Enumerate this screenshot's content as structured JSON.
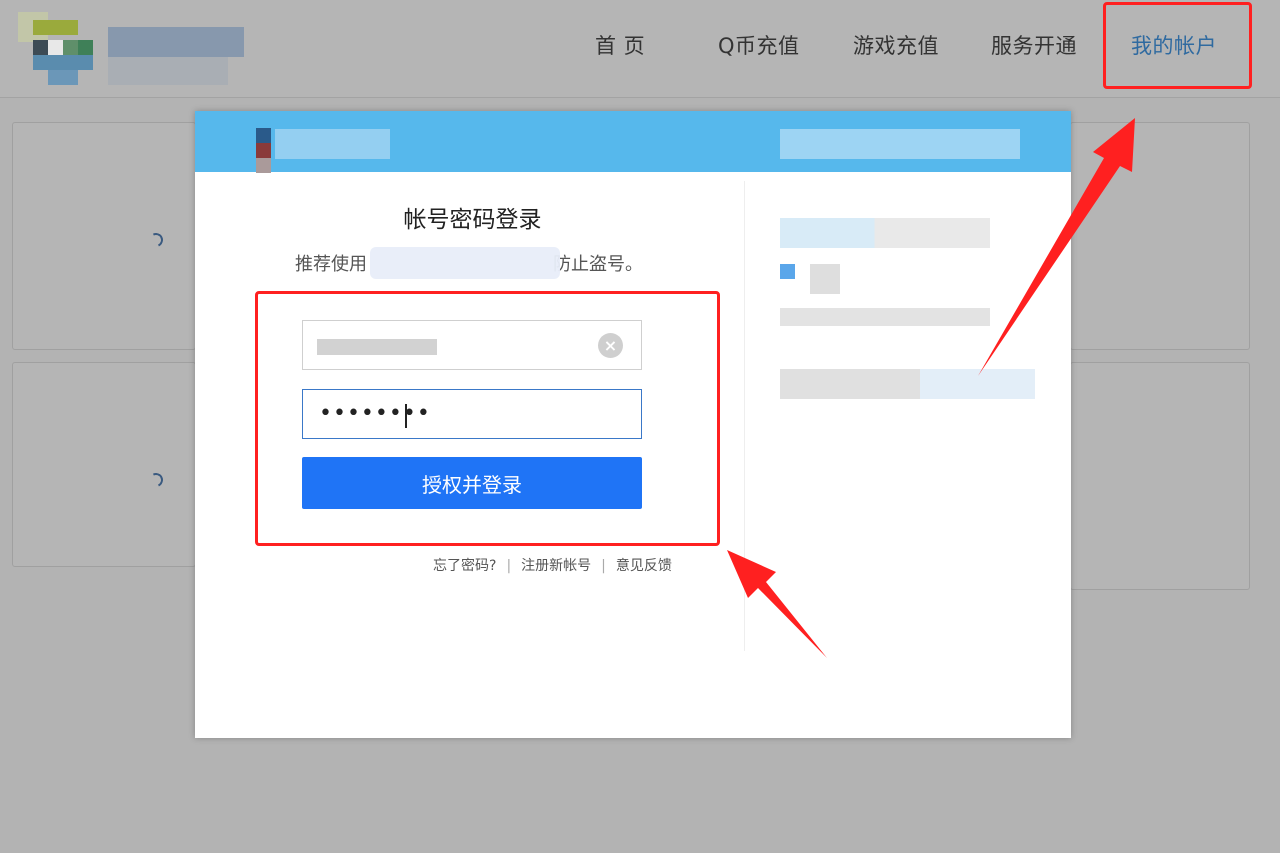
{
  "nav": {
    "items": [
      {
        "label": "首 页"
      },
      {
        "label": "Q币充值"
      },
      {
        "label": "游戏充值"
      },
      {
        "label": "服务开通"
      },
      {
        "label": "我的帐户"
      }
    ],
    "active_index": 4
  },
  "login": {
    "title": "帐号密码登录",
    "subtitle_prefix": "推荐使用",
    "subtitle_suffix": "防止盗号。",
    "password_mask": "••••••••",
    "submit_label": "授权并登录",
    "links": [
      "忘了密码?",
      "注册新帐号",
      "意见反馈"
    ],
    "separator": "|"
  },
  "colors": {
    "header_blue": "#56b8ec",
    "button_blue": "#1f74f6",
    "annotation_red": "#ff2020",
    "active_nav": "#2f6aa0"
  },
  "icons": {
    "clear": "×"
  }
}
